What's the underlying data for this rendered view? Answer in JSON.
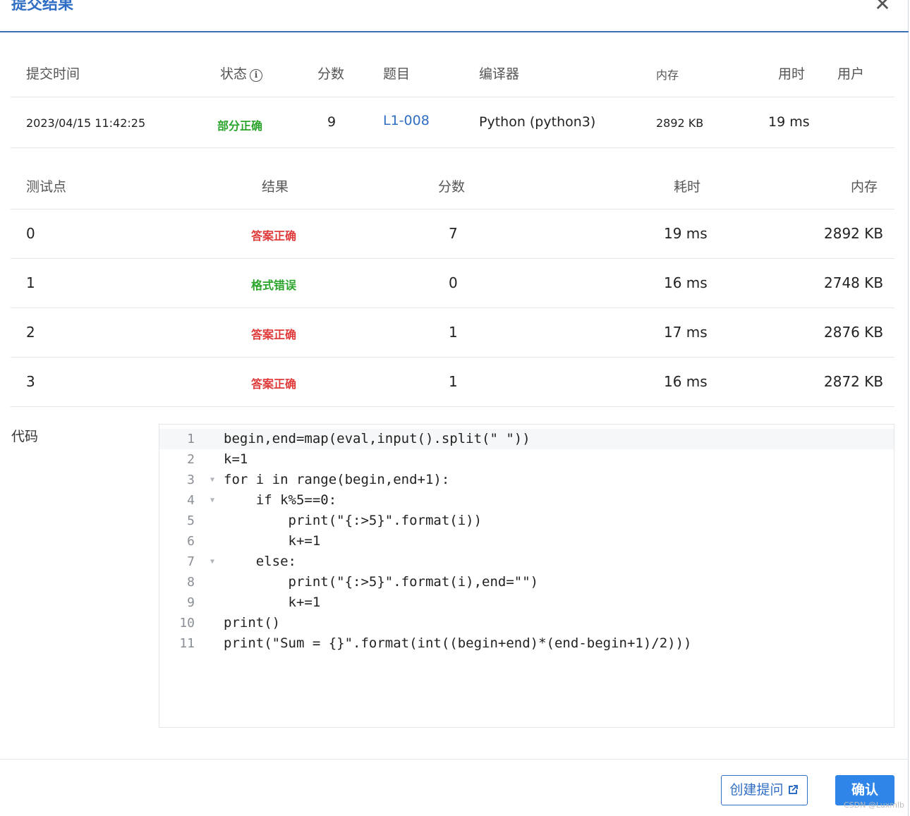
{
  "dialog": {
    "title": "提交结果",
    "close_glyph": "✕"
  },
  "summary": {
    "headers": {
      "time": "提交时间",
      "status": "状态",
      "score": "分数",
      "problem": "题目",
      "compiler": "编译器",
      "memory": "内存",
      "duration": "用时",
      "user": "用户"
    },
    "row": {
      "time": "2023/04/15 11:42:25",
      "status": "部分正确",
      "score": "9",
      "problem": "L1-008",
      "compiler": "Python (python3)",
      "memory": "2892 KB",
      "duration": "19 ms",
      "user": ""
    }
  },
  "cases": {
    "headers": {
      "point": "测试点",
      "result": "结果",
      "score": "分数",
      "time": "耗时",
      "memory": "内存"
    },
    "rows": [
      {
        "point": "0",
        "result": "答案正确",
        "result_type": "accepted",
        "score": "7",
        "time": "19 ms",
        "memory": "2892 KB"
      },
      {
        "point": "1",
        "result": "格式错误",
        "result_type": "presentation_error",
        "score": "0",
        "time": "16 ms",
        "memory": "2748 KB"
      },
      {
        "point": "2",
        "result": "答案正确",
        "result_type": "accepted",
        "score": "1",
        "time": "17 ms",
        "memory": "2876 KB"
      },
      {
        "point": "3",
        "result": "答案正确",
        "result_type": "accepted",
        "score": "1",
        "time": "16 ms",
        "memory": "2872 KB"
      }
    ]
  },
  "code": {
    "label": "代码",
    "lines": [
      {
        "n": "1",
        "fold": false,
        "text": "begin,end=map(eval,input().split(\" \"))"
      },
      {
        "n": "2",
        "fold": false,
        "text": "k=1"
      },
      {
        "n": "3",
        "fold": true,
        "text": "for i in range(begin,end+1):"
      },
      {
        "n": "4",
        "fold": true,
        "text": "    if k%5==0:"
      },
      {
        "n": "5",
        "fold": false,
        "text": "        print(\"{:>5}\".format(i))"
      },
      {
        "n": "6",
        "fold": false,
        "text": "        k+=1"
      },
      {
        "n": "7",
        "fold": true,
        "text": "    else:"
      },
      {
        "n": "8",
        "fold": false,
        "text": "        print(\"{:>5}\".format(i),end=\"\")"
      },
      {
        "n": "9",
        "fold": false,
        "text": "        k+=1"
      },
      {
        "n": "10",
        "fold": false,
        "text": "print()"
      },
      {
        "n": "11",
        "fold": false,
        "text": "print(\"Sum = {}\".format(int((begin+end)*(end-begin+1)/2)))"
      }
    ]
  },
  "footer": {
    "create_question_label": "创建提问",
    "confirm_label": "确认"
  },
  "watermark": "CSDN @Luxmlb",
  "colors": {
    "accent": "#2f6ec4",
    "primary_button": "#2f86e8",
    "accepted": "#e03b3b",
    "partial": "#2ba42b",
    "presentation_error": "#2ba42b"
  }
}
